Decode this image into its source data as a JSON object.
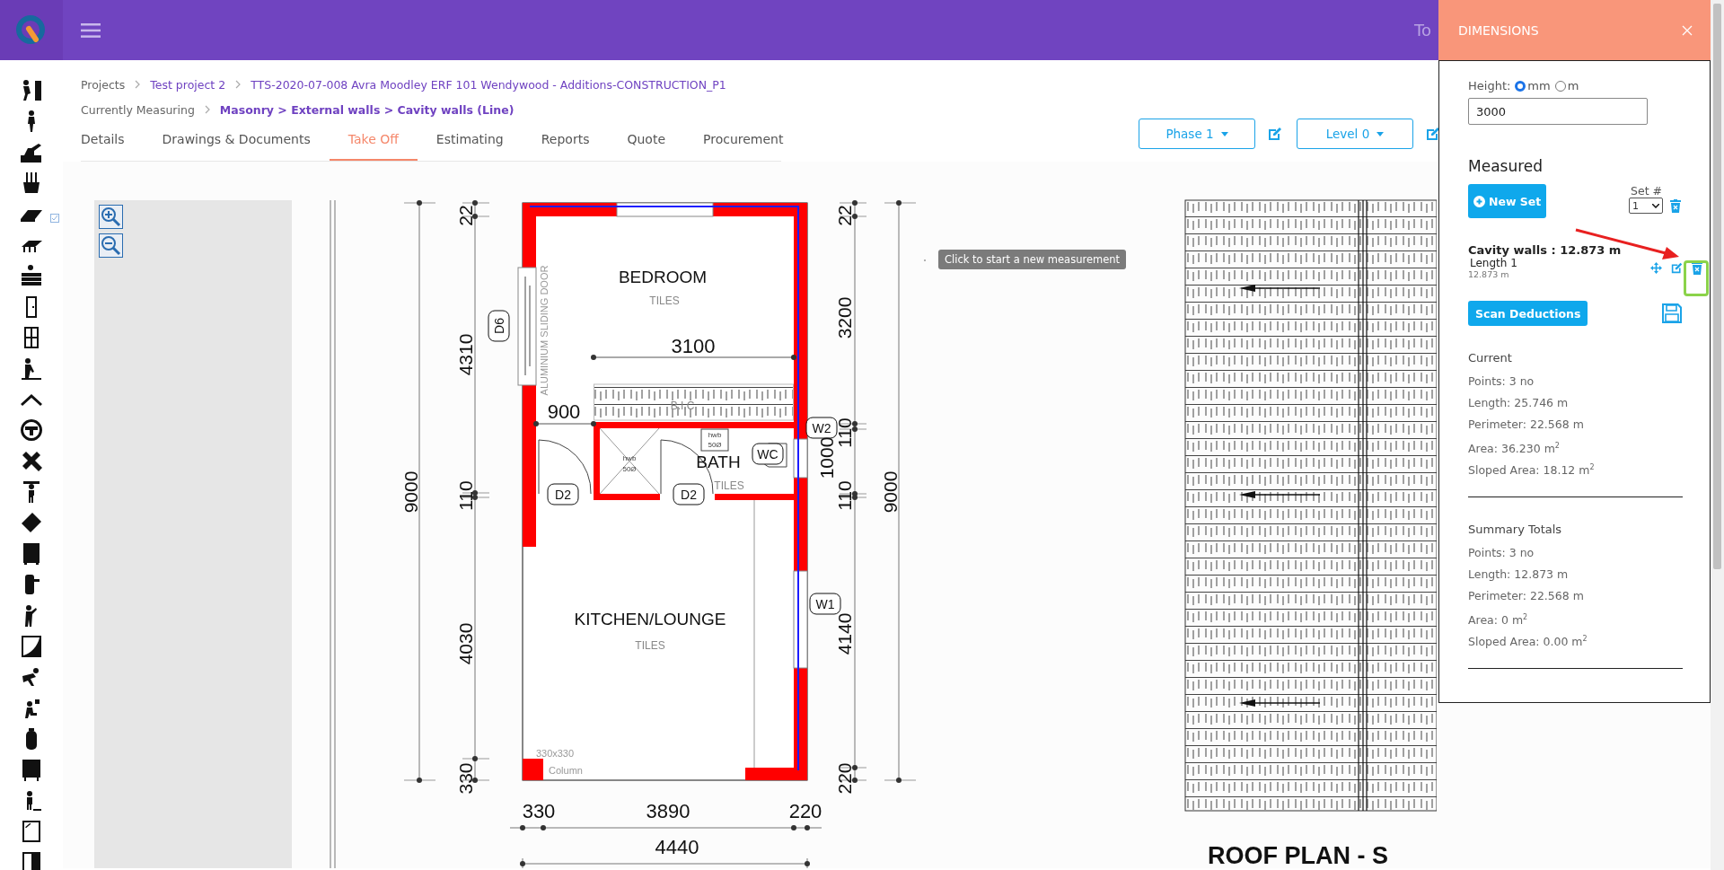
{
  "header": {
    "text": "To"
  },
  "breadcrumbs": [
    {
      "label": "Projects",
      "kind": "text"
    },
    {
      "label": "Test project 2",
      "kind": "link"
    },
    {
      "label": "TTS-2020-07-008 Avra Moodley ERF 101 Wendywood - Additions-CONSTRUCTION_P1",
      "kind": "link"
    }
  ],
  "measuring": {
    "label": "Currently Measuring",
    "path": "Masonry > External walls > Cavity walls (Line)"
  },
  "tabs": [
    {
      "label": "Details",
      "selected": false
    },
    {
      "label": "Drawings & Documents",
      "selected": false
    },
    {
      "label": "Take Off",
      "selected": true
    },
    {
      "label": "Estimating",
      "selected": false
    },
    {
      "label": "Reports",
      "selected": false
    },
    {
      "label": "Quote",
      "selected": false
    },
    {
      "label": "Procurement",
      "selected": false
    }
  ],
  "dropdowns": [
    {
      "label": "Phase 1"
    },
    {
      "label": "Level 0"
    }
  ],
  "tooltip": "Click to start a new measurement",
  "floor_plan": {
    "labels": [
      {
        "text": "BEDROOM",
        "kind": "room"
      },
      {
        "text": "TILES",
        "kind": "finish"
      },
      {
        "text": "3100",
        "kind": "dim"
      },
      {
        "text": "ALUMINIUM SLIDING DOOR",
        "kind": "note"
      },
      {
        "text": "D6",
        "kind": "tag"
      },
      {
        "text": "B.I.C",
        "kind": "finish"
      },
      {
        "text": "900",
        "kind": "dim"
      },
      {
        "text": "hwb",
        "kind": "small"
      },
      {
        "text": "50Ø",
        "kind": "small"
      },
      {
        "text": "hwb",
        "kind": "small"
      },
      {
        "text": "50Ø",
        "kind": "small"
      },
      {
        "text": "BATH",
        "kind": "room"
      },
      {
        "text": "WC",
        "kind": "tag"
      },
      {
        "text": "TILES",
        "kind": "finish"
      },
      {
        "text": "D2",
        "kind": "tag"
      },
      {
        "text": "D2",
        "kind": "tag"
      },
      {
        "text": "W2",
        "kind": "tag"
      },
      {
        "text": "W1",
        "kind": "tag"
      },
      {
        "text": "KITCHEN/LOUNGE",
        "kind": "room"
      },
      {
        "text": "TILES",
        "kind": "finish"
      },
      {
        "text": "330x330",
        "kind": "note"
      },
      {
        "text": "Column",
        "kind": "note"
      },
      {
        "text": "22",
        "kind": "vdim"
      },
      {
        "text": "4310",
        "kind": "vdim"
      },
      {
        "text": "110",
        "kind": "vdim"
      },
      {
        "text": "4030",
        "kind": "vdim"
      },
      {
        "text": "330",
        "kind": "vdim"
      },
      {
        "text": "9000",
        "kind": "vdim"
      },
      {
        "text": "22",
        "kind": "vdim"
      },
      {
        "text": "3200",
        "kind": "vdim"
      },
      {
        "text": "110",
        "kind": "vdim"
      },
      {
        "text": "1000",
        "kind": "vdim"
      },
      {
        "text": "110",
        "kind": "vdim"
      },
      {
        "text": "4140",
        "kind": "vdim"
      },
      {
        "text": "220",
        "kind": "vdim"
      },
      {
        "text": "9000",
        "kind": "vdim"
      },
      {
        "text": "330",
        "kind": "dim"
      },
      {
        "text": "3890",
        "kind": "dim"
      },
      {
        "text": "220",
        "kind": "dim"
      },
      {
        "text": "4440",
        "kind": "dim"
      }
    ]
  },
  "roof_plan": {
    "title": "ROOF PLAN - S"
  },
  "dimensions_panel": {
    "title": "DIMENSIONS",
    "height_label": "Height:",
    "units": [
      {
        "label": "mm",
        "selected": true
      },
      {
        "label": "m",
        "selected": false
      }
    ],
    "height_value": "3000",
    "measured_title": "Measured",
    "new_set_button": "New Set",
    "set_label": "Set #",
    "set_value": "1",
    "measurement": {
      "title": "Cavity walls : 12.873 m",
      "items": [
        {
          "name": "Length 1",
          "value": "12.873 m"
        }
      ]
    },
    "scan_button": "Scan Deductions",
    "sections": [
      {
        "title": "Current",
        "lines": [
          "Points: 3 no",
          "Length: 25.746 m",
          "Perimeter: 22.568 m",
          "Area: 36.230 m$^{2}$",
          "Sloped Area: 18.12 m$^{2}$"
        ]
      },
      {
        "title": "Summary Totals",
        "lines": [
          "Points: 3 no",
          "Length: 12.873 m",
          "Perimeter: 22.568 m",
          "Area: 0 m$^{2}$",
          "Sloped Area: 0.00 m$^{2}$"
        ]
      }
    ]
  }
}
